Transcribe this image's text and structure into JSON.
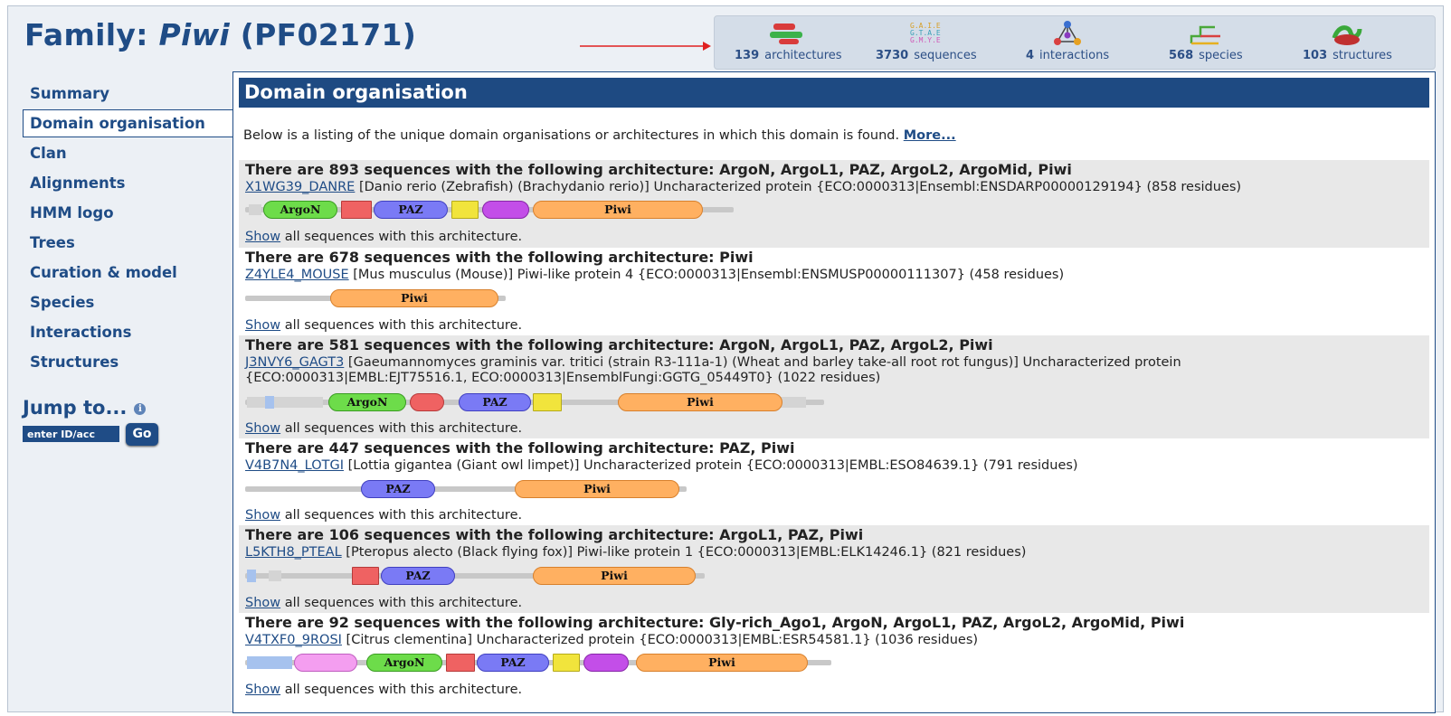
{
  "header": {
    "title_prefix": "Family: ",
    "title_name": "Piwi",
    "title_acc": "(PF02171)"
  },
  "stats": [
    {
      "count": "139",
      "label": "architectures",
      "icon": "architectures-icon"
    },
    {
      "count": "3730",
      "label": "sequences",
      "icon": "sequences-icon"
    },
    {
      "count": "4",
      "label": "interactions",
      "icon": "interactions-icon"
    },
    {
      "count": "568",
      "label": "species",
      "icon": "species-icon"
    },
    {
      "count": "103",
      "label": "structures",
      "icon": "structures-icon"
    }
  ],
  "sidebar": {
    "items": [
      {
        "label": "Summary"
      },
      {
        "label": "Domain organisation",
        "active": true
      },
      {
        "label": "Clan"
      },
      {
        "label": "Alignments"
      },
      {
        "label": "HMM logo"
      },
      {
        "label": "Trees"
      },
      {
        "label": "Curation & model"
      },
      {
        "label": "Species"
      },
      {
        "label": "Interactions"
      },
      {
        "label": "Structures"
      }
    ],
    "jump_title": "Jump to...",
    "jump_placeholder": "enter ID/acc",
    "go_label": "Go"
  },
  "main": {
    "section_title": "Domain organisation",
    "intro_text": "Below is a listing of the unique domain organisations or architectures in which this domain is found. ",
    "intro_more": "More...",
    "show_link": "Show",
    "show_suffix": " all sequences with this architecture.",
    "architectures": [
      {
        "title": "There are 893 sequences with the following architecture: ArgoN, ArgoL1, PAZ, ArgoL2, ArgoMid, Piwi",
        "seq_id": "X1WG39_DANRE",
        "desc": " [Danio rerio (Zebrafish) (Brachydanio rerio)] Uncharacterized protein {ECO:0000313|Ensembl:ENSDARP00000129194} (858 residues)",
        "domains": [
          "ArgoN",
          "PAZ",
          "Piwi"
        ]
      },
      {
        "title": "There are 678 sequences with the following architecture: Piwi",
        "seq_id": "Z4YLE4_MOUSE",
        "desc": " [Mus musculus (Mouse)] Piwi-like protein 4 {ECO:0000313|Ensembl:ENSMUSP00000111307} (458 residues)",
        "domains": [
          "Piwi"
        ]
      },
      {
        "title": "There are 581 sequences with the following architecture: ArgoN, ArgoL1, PAZ, ArgoL2, Piwi",
        "seq_id": "J3NVY6_GAGT3",
        "desc": " [Gaeumannomyces graminis var. tritici (strain R3-111a-1) (Wheat and barley take-all root rot fungus)] Uncharacterized protein {ECO:0000313|EMBL:EJT75516.1, ECO:0000313|EnsemblFungi:GGTG_05449T0} (1022 residues)",
        "domains": [
          "ArgoN",
          "PAZ",
          "Piwi"
        ]
      },
      {
        "title": "There are 447 sequences with the following architecture: PAZ, Piwi",
        "seq_id": "V4B7N4_LOTGI",
        "desc": " [Lottia gigantea (Giant owl limpet)] Uncharacterized protein {ECO:0000313|EMBL:ESO84639.1} (791 residues)",
        "domains": [
          "PAZ",
          "Piwi"
        ]
      },
      {
        "title": "There are 106 sequences with the following architecture: ArgoL1, PAZ, Piwi",
        "seq_id": "L5KTH8_PTEAL",
        "desc": " [Pteropus alecto (Black flying fox)] Piwi-like protein 1 {ECO:0000313|EMBL:ELK14246.1} (821 residues)",
        "domains": [
          "PAZ",
          "Piwi"
        ]
      },
      {
        "title": "There are 92 sequences with the following architecture: Gly-rich_Ago1, ArgoN, ArgoL1, PAZ, ArgoL2, ArgoMid, Piwi",
        "seq_id": "V4TXF0_9ROSI",
        "desc": " [Citrus clementina] Uncharacterized protein {ECO:0000313|EMBL:ESR54581.1} (1036 residues)",
        "domains": [
          "ArgoN",
          "PAZ",
          "Piwi"
        ]
      }
    ]
  },
  "colors": {
    "brand_blue": "#1f4c86",
    "header_blue": "#1e4a82",
    "argon": "#6ddc4a",
    "argol1": "#ef6262",
    "paz": "#7a7af5",
    "argol2": "#f1e43c",
    "argomid": "#c34ee8",
    "piwi": "#ffb061",
    "gly_rich": "#f49ef0"
  }
}
